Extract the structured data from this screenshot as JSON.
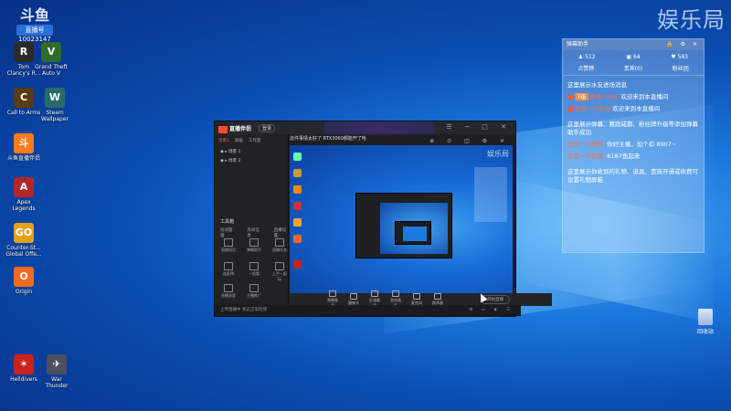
{
  "watermark": "娱乐局",
  "room_badge": {
    "logo": "斗鱼",
    "tag": "直播号",
    "room_id": "10023147"
  },
  "desktop_icons": [
    {
      "label": "Tom\nClancy's R...",
      "color": "#2b2b2b",
      "glyph": "R"
    },
    {
      "label": "Grand Theft\nAuto V",
      "color": "#2f6b2a",
      "glyph": "V"
    },
    {
      "label": "Call to Arms",
      "color": "#5a3b1a",
      "glyph": "C"
    },
    {
      "label": "Steam\nWallpaper",
      "color": "#2a6b6a",
      "glyph": "W"
    },
    {
      "label": "斗鱼直播伴侣",
      "color": "#ff7a1a",
      "glyph": "斗"
    },
    {
      "label": "Apex\nLegends",
      "color": "#b4262b",
      "glyph": "A"
    },
    {
      "label": "Counter-St...\nGlobal Offe...",
      "color": "#e5a01a",
      "glyph": "GO"
    },
    {
      "label": "Origin",
      "color": "#f26a21",
      "glyph": "O"
    },
    {
      "label": "Helldivers",
      "color": "#c8241c",
      "glyph": "✶"
    },
    {
      "label": "War\nThunder",
      "color": "#4a5060",
      "glyph": "✈"
    }
  ],
  "chat_panel": {
    "title": "弹幕助手",
    "controls": "🔒 ⚙ ×",
    "stats": {
      "fans": "512",
      "gifts": "64",
      "likes": "583"
    },
    "tabs": [
      "点赞榜",
      "贵宾(0)",
      "粉丝团"
    ],
    "messages": [
      {
        "type": "notice",
        "text": "这里展示水友进场消息"
      },
      {
        "type": "enter",
        "level": "7级",
        "name": "陈瑜CONE",
        "text": "欢迎来到本直播间"
      },
      {
        "type": "enter",
        "level": "",
        "name": "这是一只鱼呢",
        "text": "欢迎来到本直播间"
      },
      {
        "type": "notice",
        "text": "这里展示弹幕、赛跑咸鹅、粉丝牌升级等添加弹幕助手成功"
      },
      {
        "type": "gift",
        "name": "这是一只鱼呢:",
        "text": "你好主播，加个扣 8907~"
      },
      {
        "type": "gift",
        "name": "这是一只鱼呢:",
        "text": "6187鱼起来"
      },
      {
        "type": "notice",
        "text": "这里展示你收到的礼物、道具、贵族开通或续费可设置礼物屏蔽"
      }
    ]
  },
  "app": {
    "brand": "直播伴侣",
    "title_button": "登录",
    "left_tabs": [
      "场景1",
      "高级",
      "工作室"
    ],
    "scenes": [
      "场景 1",
      "场景 2"
    ],
    "tools_title": "工具箱",
    "tools_row": [
      "房间管理",
      "房间信息",
      "直播设置"
    ],
    "tools": [
      "直播间设",
      "弹幕助手",
      "直播任务",
      "连麦PK",
      "一起看",
      "上手一起玩",
      "直播录屏",
      "主播推广"
    ],
    "preview_title": "这件事情太好了 RTX3060都能开了哈",
    "preview_watermark": "娱乐局",
    "bottom_buttons": [
      "直播画面",
      "摄像头",
      "区域截屏",
      "游戏画面",
      "麦克风",
      "扬声器"
    ],
    "start_button": "开始直播",
    "status": "上传直播中 状态正常检测",
    "status_right": "⚙ ▭ ◐ ☰"
  },
  "recycle_bin": "回收站"
}
